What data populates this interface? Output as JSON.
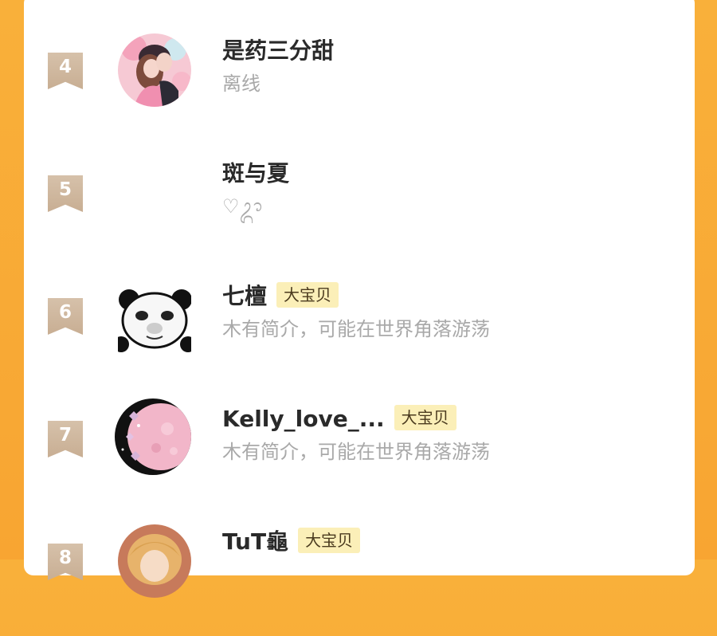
{
  "leaderboard": {
    "entries": [
      {
        "rank": "4",
        "name": "是药三分甜",
        "badge": "",
        "status": "离线",
        "avatar_icon": "couple-illustration-avatar"
      },
      {
        "rank": "5",
        "name": "斑与夏",
        "badge": "",
        "status": "♡ᬊ",
        "avatar_icon": "blank-avatar"
      },
      {
        "rank": "6",
        "name": "七檀",
        "badge": "大宝贝",
        "status": "木有简介，可能在世界角落游荡",
        "avatar_icon": "panda-meme-avatar"
      },
      {
        "rank": "7",
        "name": "Kelly_love_...",
        "badge": "大宝贝",
        "status": "木有简介，可能在世界角落游荡",
        "avatar_icon": "pink-moon-avatar"
      },
      {
        "rank": "8",
        "name": "TuT龜",
        "badge": "大宝贝",
        "status": "",
        "avatar_icon": "anime-girl-avatar"
      }
    ]
  },
  "colors": {
    "background": "#f9b03a",
    "card": "#ffffff",
    "rank_badge": "#cdb59b",
    "tag_bg": "#fbefb8",
    "name_text": "#2a2a2a",
    "status_text": "#a9a9a9"
  }
}
